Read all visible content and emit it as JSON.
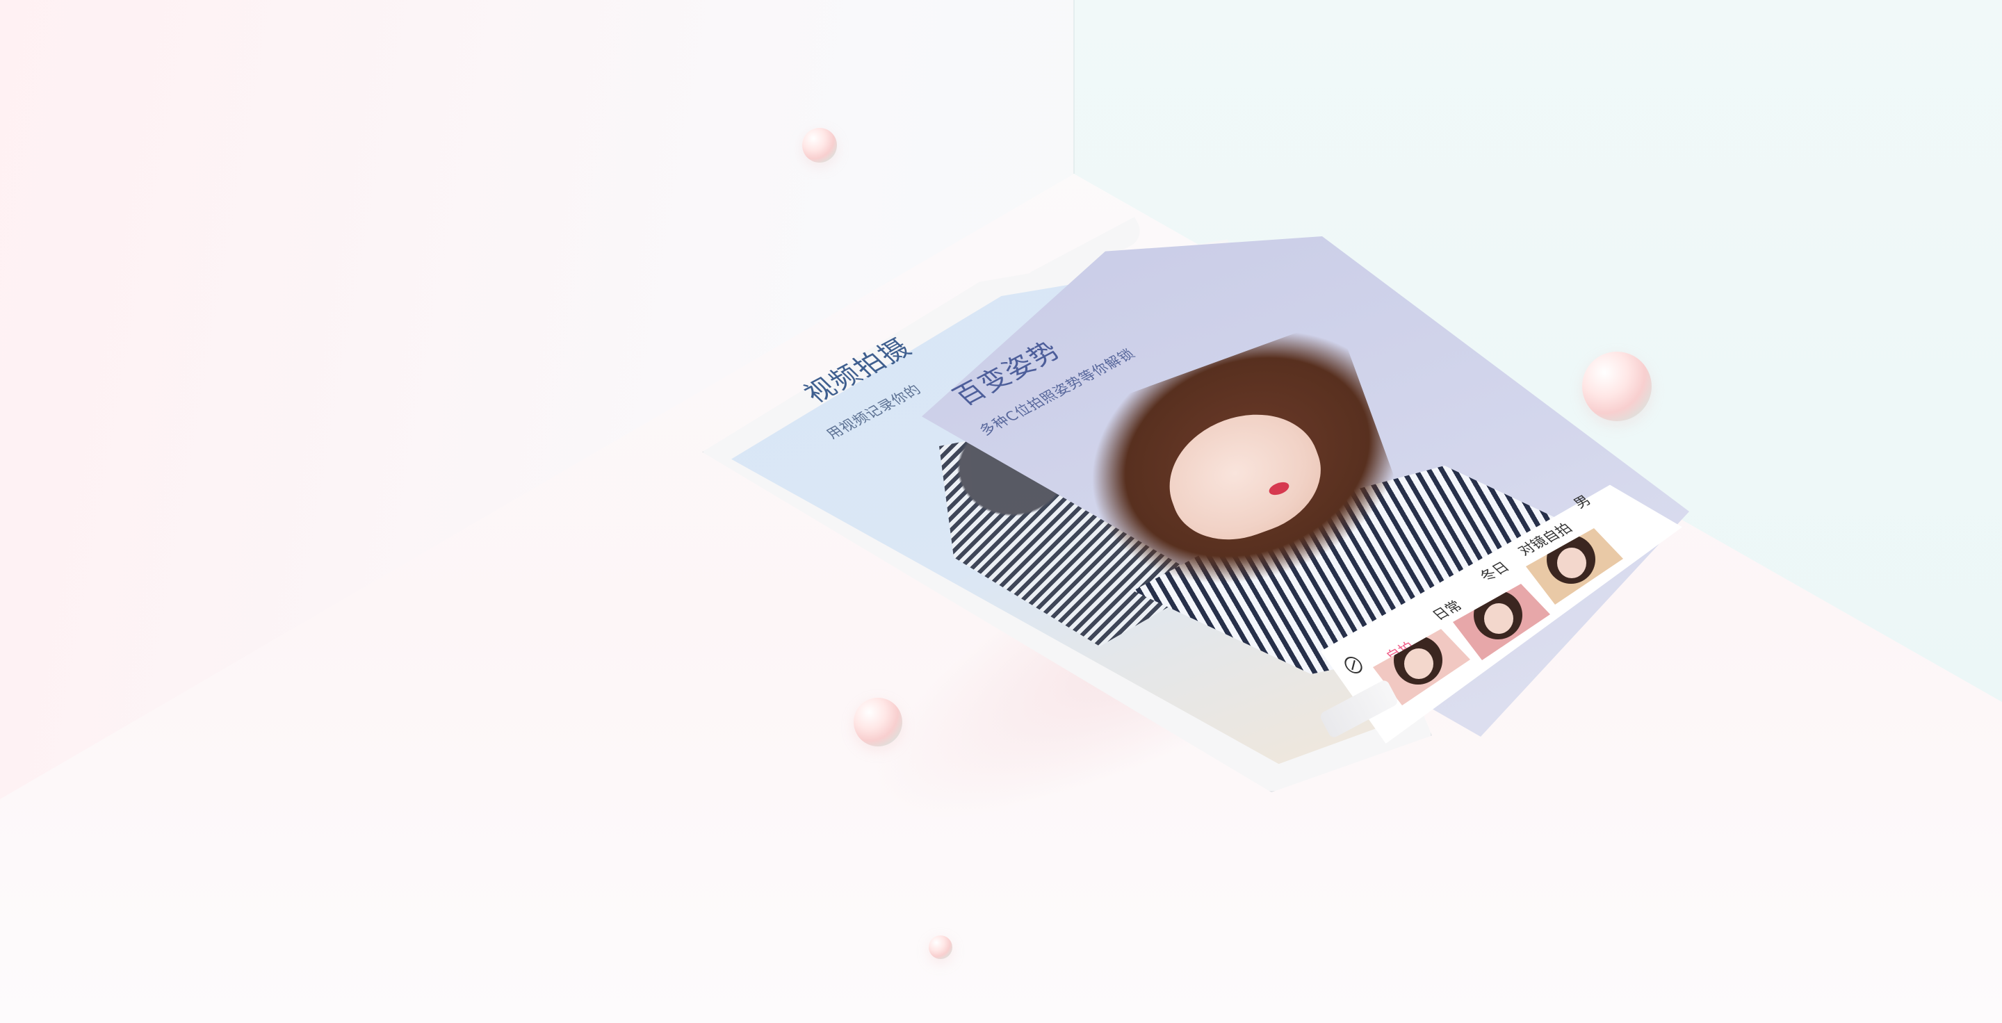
{
  "back_screen": {
    "title": "视频拍摄",
    "subtitle": "用视频记录你的"
  },
  "front_screen": {
    "title": "百变姿势",
    "subtitle": "多种C位拍照姿势等你解锁"
  },
  "panel": {
    "tabs": [
      {
        "label": "自拍",
        "active": true
      },
      {
        "label": "日常",
        "active": false
      },
      {
        "label": "冬日",
        "active": false
      },
      {
        "label": "对镜自拍",
        "active": false
      },
      {
        "label": "男",
        "active": false
      }
    ],
    "icon": "disable-icon",
    "thumbnails": [
      {
        "name": "pose-thumb-1",
        "bg": "#f1c8c2"
      },
      {
        "name": "pose-thumb-2",
        "bg": "#e7a7a9"
      },
      {
        "name": "pose-thumb-3",
        "bg": "#e9c9a6"
      }
    ]
  },
  "colors": {
    "accent": "#f0608a",
    "screen_back": "#d6e6f7",
    "screen_front": "#c8cbe6"
  }
}
